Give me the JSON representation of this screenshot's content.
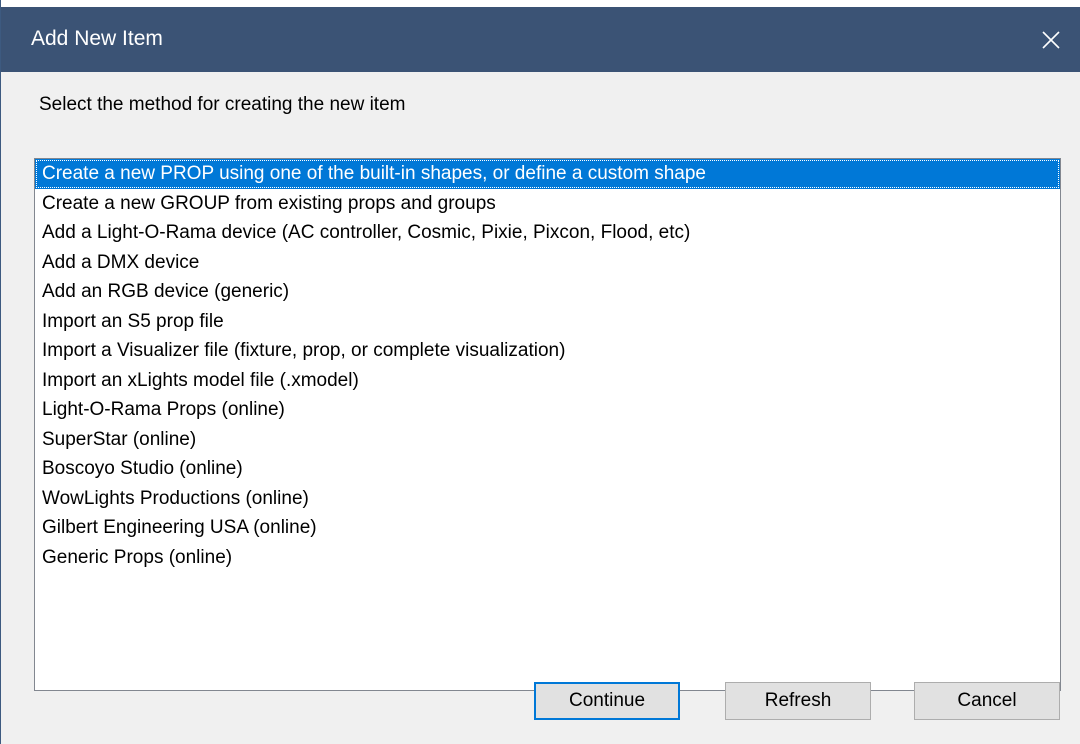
{
  "window": {
    "title": "Add New Item"
  },
  "dialog": {
    "prompt": "Select the method for creating the new item"
  },
  "list": {
    "selected_index": 0,
    "items": [
      "Create a new PROP using one of the built-in shapes, or define a custom shape",
      "Create a new GROUP from existing props and groups",
      "Add a Light-O-Rama device (AC controller, Cosmic, Pixie, Pixcon, Flood, etc)",
      "Add a DMX device",
      "Add an RGB device (generic)",
      "Import an S5 prop file",
      "Import a Visualizer file (fixture, prop, or complete visualization)",
      "Import an xLights model file (.xmodel)",
      "Light-O-Rama Props (online)",
      "SuperStar (online)",
      "Boscoyo Studio (online)",
      "WowLights Productions (online)",
      "Gilbert Engineering USA (online)",
      "Generic Props (online)"
    ]
  },
  "buttons": {
    "continue": "Continue",
    "refresh": "Refresh",
    "cancel": "Cancel"
  },
  "icons": {
    "close": "close-icon"
  },
  "colors": {
    "titlebar": "#3b5375",
    "selection": "#0078d7",
    "dialog_bg": "#f0f0f0",
    "button_bg": "#e1e1e1"
  }
}
